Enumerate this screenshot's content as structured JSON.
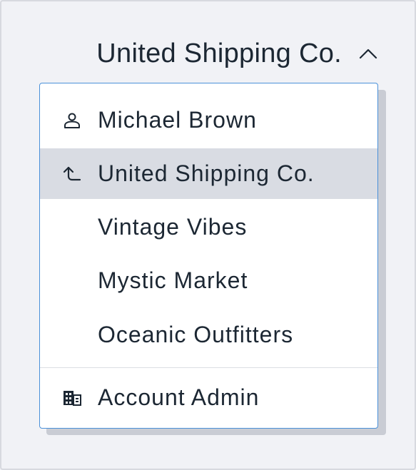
{
  "account_switcher": {
    "current_account": "United Shipping Co.",
    "chevron_icon": "chevron-up-icon"
  },
  "menu": {
    "user": {
      "label": "Michael Brown",
      "icon": "user-icon"
    },
    "parent_account": {
      "label": "United Shipping Co.",
      "icon": "return-up-icon",
      "selected": true
    },
    "sub_accounts": [
      {
        "label": "Vintage Vibes"
      },
      {
        "label": "Mystic Market"
      },
      {
        "label": "Oceanic Outfitters"
      }
    ],
    "admin": {
      "label": "Account Admin",
      "icon": "building-icon"
    }
  },
  "colors": {
    "background": "#f1f2f6",
    "text": "#1c2733",
    "menu_border": "#4a90d9",
    "selected_row": "#d9dce3"
  }
}
